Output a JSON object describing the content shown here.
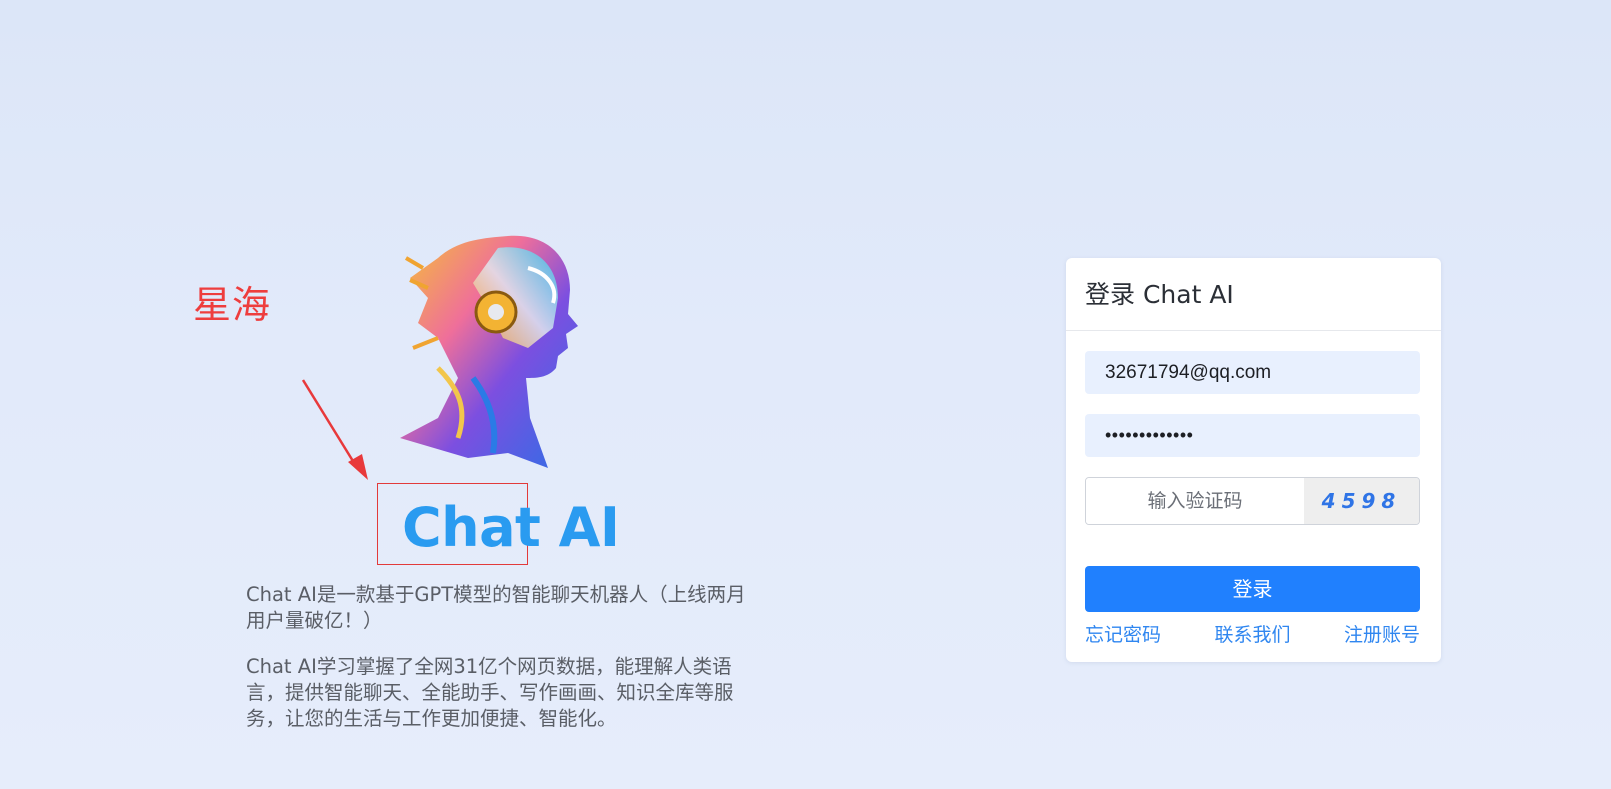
{
  "annotation": {
    "label": "星海"
  },
  "brand": {
    "title": "Chat AI"
  },
  "descriptions": [
    "Chat AI是一款基于GPT模型的智能聊天机器人（上线两月用户量破亿！）",
    "Chat AI学习掌握了全网31亿个网页数据，能理解人类语言，提供智能聊天、全能助手、写作画画、知识全库等服务，让您的生活与工作更加便捷、智能化。"
  ],
  "login": {
    "title": "登录 Chat AI",
    "email": "32671794@qq.com",
    "password_masked": "•••••••••••••",
    "captcha_placeholder": "输入验证码",
    "captcha_code": "4598",
    "submit_label": "登录",
    "links": {
      "forgot": "忘记密码",
      "contact": "联系我们",
      "register": "注册账号"
    }
  },
  "colors": {
    "primary": "#2080fe",
    "brand_text": "#2a9bf0",
    "annotation": "#ee3d3d"
  }
}
